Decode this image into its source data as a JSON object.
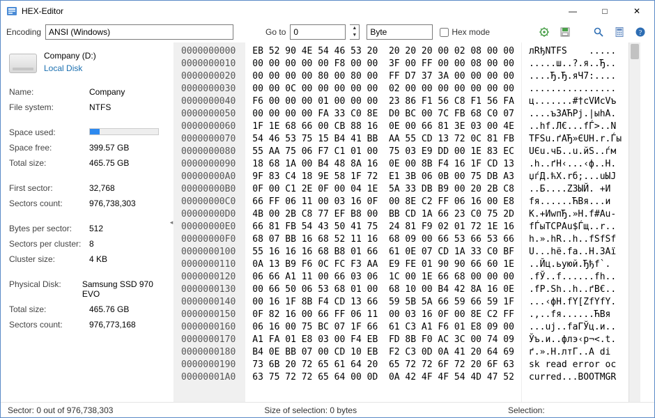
{
  "window": {
    "title": "HEX-Editor"
  },
  "toolbar": {
    "encoding_label": "Encoding",
    "encoding_value": "ANSI (Windows)",
    "goto_label": "Go to",
    "goto_value": "0",
    "unit_value": "Byte",
    "hexmode_label": "Hex mode",
    "hexmode_checked": false
  },
  "disk": {
    "name_header": "Company (D:)",
    "type": "Local Disk",
    "rows1": [
      {
        "k": "Name:",
        "v": "Company"
      },
      {
        "k": "File system:",
        "v": "NTFS"
      }
    ],
    "used_label": "Space used:",
    "used_pct": 14,
    "rows2": [
      {
        "k": "Space free:",
        "v": "399.57 GB"
      },
      {
        "k": "Total size:",
        "v": "465.75 GB"
      }
    ],
    "rows3": [
      {
        "k": "First sector:",
        "v": "32,768"
      },
      {
        "k": "Sectors count:",
        "v": "976,738,303"
      }
    ],
    "rows4": [
      {
        "k": "Bytes per sector:",
        "v": "512"
      },
      {
        "k": "Sectors per cluster:",
        "v": "8"
      },
      {
        "k": "Cluster size:",
        "v": "4 KB"
      }
    ],
    "rows5": [
      {
        "k": "Physical Disk:",
        "v": "Samsung SSD 970 EVO"
      },
      {
        "k": "Total size:",
        "v": "465.76 GB"
      },
      {
        "k": "Sectors count:",
        "v": "976,773,168"
      }
    ]
  },
  "hex": {
    "offsets": [
      "0000000000",
      "0000000010",
      "0000000020",
      "0000000030",
      "0000000040",
      "0000000050",
      "0000000060",
      "0000000070",
      "0000000080",
      "0000000090",
      "00000000A0",
      "00000000B0",
      "00000000C0",
      "00000000D0",
      "00000000E0",
      "00000000F0",
      "0000000100",
      "0000000110",
      "0000000120",
      "0000000130",
      "0000000140",
      "0000000150",
      "0000000160",
      "0000000170",
      "0000000180",
      "0000000190",
      "00000001A0"
    ],
    "bytes": [
      "EB 52 90 4E 54 46 53 20  20 20 20 00 02 08 00 00",
      "00 00 00 00 00 F8 00 00  3F 00 FF 00 00 08 00 00",
      "00 00 00 00 80 00 80 00  FF D7 37 3A 00 00 00 00",
      "00 00 0C 00 00 00 00 00  02 00 00 00 00 00 00 00",
      "F6 00 00 00 01 00 00 00  23 86 F1 56 C8 F1 56 FA",
      "00 00 00 00 FA 33 C0 8E  D0 BC 00 7C FB 68 C0 07",
      "1F 1E 68 66 00 CB 88 16  0E 00 66 81 3E 03 00 4E",
      "54 46 53 75 15 B4 41 BB  AA 55 CD 13 72 0C 81 FB",
      "55 AA 75 06 F7 C1 01 00  75 03 E9 DD 00 1E 83 EC",
      "18 68 1A 00 B4 48 8A 16  0E 00 8B F4 16 1F CD 13",
      "9F 83 C4 18 9E 58 1F 72  E1 3B 06 0B 00 75 DB A3",
      "0F 00 C1 2E 0F 00 04 1E  5A 33 DB B9 00 20 2B C8",
      "66 FF 06 11 00 03 16 0F  00 8E C2 FF 06 16 00 E8",
      "4B 00 2B C8 77 EF B8 00  BB CD 1A 66 23 C0 75 2D",
      "66 81 FB 54 43 50 41 75  24 81 F9 02 01 72 1E 16",
      "68 07 BB 16 68 52 11 16  68 09 00 66 53 66 53 66",
      "55 16 16 16 68 B8 01 66  61 0E 07 CD 1A 33 C0 BF",
      "0A 13 B9 F6 0C FC F3 AA  E9 FE 01 90 90 66 60 1E",
      "06 66 A1 11 00 66 03 06  1C 00 1E 66 68 00 00 00",
      "00 66 50 06 53 68 01 00  68 10 00 B4 42 8A 16 0E",
      "00 16 1F 8B F4 CD 13 66  59 5B 5A 66 59 66 59 1F",
      "0F 82 16 00 66 FF 06 11  00 03 16 0F 00 8E C2 FF",
      "06 16 00 75 BC 07 1F 66  61 C3 A1 F6 01 E8 09 00",
      "A1 FA 01 E8 03 00 F4 EB  FD 8B F0 AC 3C 00 74 09",
      "B4 0E BB 07 00 CD 10 EB  F2 C3 0D 0A 41 20 64 69",
      "73 6B 20 72 65 61 64 20  65 72 72 6F 72 20 6F 63",
      "63 75 72 72 65 64 00 0D  0A 42 4F 4F 54 4D 47 52"
    ],
    "text": [
      "лRђNTFS    .....",
      ".....ш..?.я..Ђ..",
      "....Ђ.Ђ.яЧ7:....",
      "................",
      "ц.......#†сVИсVъ",
      "....ъЗАЋРј.|ыhА.",
      "..hf.Л€...fЃ>..N",
      "TFSu.ґAЂ»ЄUН.r.Ѓы",
      "UЄu.чБ..u.йЅ..ѓм",
      ".h..ґH‹...‹ф..Н.",
      "џѓД.ћX.rб;...uЫJ",
      "..Б....Z3ЫЙ. +И",
      "fя......ЋВя...и",
      "K.+ИwпЂ.»Н.f#Аu-",
      "fЃыTCPAu$Ѓщ..r..",
      "h.».hR..h..fSfSf",
      "U...hё.fa..Н.3Аї",
      "..Йц.ьуюй.Ђђf`.",
      ".fЎ..f......fh..",
      ".fP.Sh..h..ґB€..",
      "...‹фН.fY[ZfYfY.",
      ".‚..fя......ЋВя",
      "...uј..faГЎц.и..",
      "Ўъ.и..флэ‹р¬<.t.",
      "ґ.».Н.лтГ..A di",
      "sk read error oc",
      "curred...BOOTMGR"
    ]
  },
  "status": {
    "sector": "Sector:  0 out of 976,738,303",
    "selection_size": "Size of selection: 0 bytes",
    "selection": "Selection:"
  }
}
